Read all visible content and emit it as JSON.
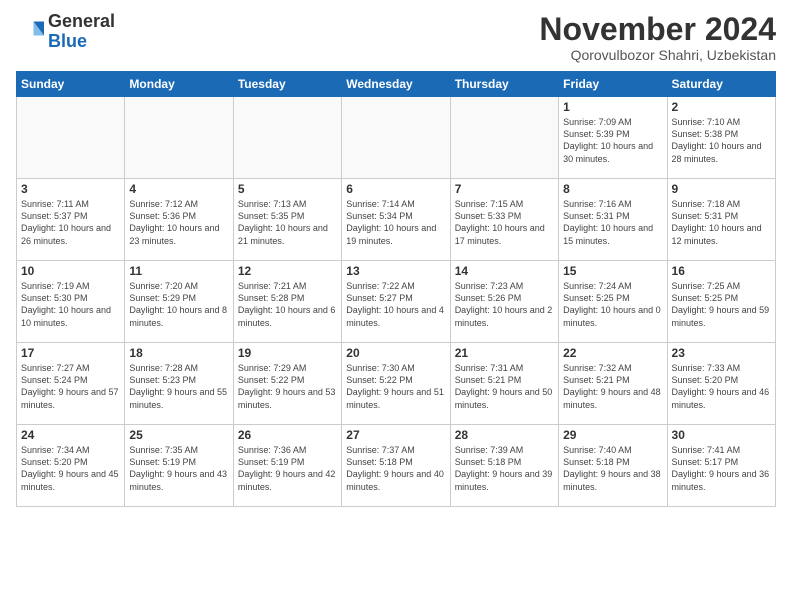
{
  "header": {
    "logo_general": "General",
    "logo_blue": "Blue",
    "month_title": "November 2024",
    "location": "Qorovulbozor Shahri, Uzbekistan"
  },
  "weekdays": [
    "Sunday",
    "Monday",
    "Tuesday",
    "Wednesday",
    "Thursday",
    "Friday",
    "Saturday"
  ],
  "weeks": [
    [
      {
        "day": "",
        "info": ""
      },
      {
        "day": "",
        "info": ""
      },
      {
        "day": "",
        "info": ""
      },
      {
        "day": "",
        "info": ""
      },
      {
        "day": "",
        "info": ""
      },
      {
        "day": "1",
        "info": "Sunrise: 7:09 AM\nSunset: 5:39 PM\nDaylight: 10 hours\nand 30 minutes."
      },
      {
        "day": "2",
        "info": "Sunrise: 7:10 AM\nSunset: 5:38 PM\nDaylight: 10 hours\nand 28 minutes."
      }
    ],
    [
      {
        "day": "3",
        "info": "Sunrise: 7:11 AM\nSunset: 5:37 PM\nDaylight: 10 hours\nand 26 minutes."
      },
      {
        "day": "4",
        "info": "Sunrise: 7:12 AM\nSunset: 5:36 PM\nDaylight: 10 hours\nand 23 minutes."
      },
      {
        "day": "5",
        "info": "Sunrise: 7:13 AM\nSunset: 5:35 PM\nDaylight: 10 hours\nand 21 minutes."
      },
      {
        "day": "6",
        "info": "Sunrise: 7:14 AM\nSunset: 5:34 PM\nDaylight: 10 hours\nand 19 minutes."
      },
      {
        "day": "7",
        "info": "Sunrise: 7:15 AM\nSunset: 5:33 PM\nDaylight: 10 hours\nand 17 minutes."
      },
      {
        "day": "8",
        "info": "Sunrise: 7:16 AM\nSunset: 5:31 PM\nDaylight: 10 hours\nand 15 minutes."
      },
      {
        "day": "9",
        "info": "Sunrise: 7:18 AM\nSunset: 5:31 PM\nDaylight: 10 hours\nand 12 minutes."
      }
    ],
    [
      {
        "day": "10",
        "info": "Sunrise: 7:19 AM\nSunset: 5:30 PM\nDaylight: 10 hours\nand 10 minutes."
      },
      {
        "day": "11",
        "info": "Sunrise: 7:20 AM\nSunset: 5:29 PM\nDaylight: 10 hours\nand 8 minutes."
      },
      {
        "day": "12",
        "info": "Sunrise: 7:21 AM\nSunset: 5:28 PM\nDaylight: 10 hours\nand 6 minutes."
      },
      {
        "day": "13",
        "info": "Sunrise: 7:22 AM\nSunset: 5:27 PM\nDaylight: 10 hours\nand 4 minutes."
      },
      {
        "day": "14",
        "info": "Sunrise: 7:23 AM\nSunset: 5:26 PM\nDaylight: 10 hours\nand 2 minutes."
      },
      {
        "day": "15",
        "info": "Sunrise: 7:24 AM\nSunset: 5:25 PM\nDaylight: 10 hours\nand 0 minutes."
      },
      {
        "day": "16",
        "info": "Sunrise: 7:25 AM\nSunset: 5:25 PM\nDaylight: 9 hours\nand 59 minutes."
      }
    ],
    [
      {
        "day": "17",
        "info": "Sunrise: 7:27 AM\nSunset: 5:24 PM\nDaylight: 9 hours\nand 57 minutes."
      },
      {
        "day": "18",
        "info": "Sunrise: 7:28 AM\nSunset: 5:23 PM\nDaylight: 9 hours\nand 55 minutes."
      },
      {
        "day": "19",
        "info": "Sunrise: 7:29 AM\nSunset: 5:22 PM\nDaylight: 9 hours\nand 53 minutes."
      },
      {
        "day": "20",
        "info": "Sunrise: 7:30 AM\nSunset: 5:22 PM\nDaylight: 9 hours\nand 51 minutes."
      },
      {
        "day": "21",
        "info": "Sunrise: 7:31 AM\nSunset: 5:21 PM\nDaylight: 9 hours\nand 50 minutes."
      },
      {
        "day": "22",
        "info": "Sunrise: 7:32 AM\nSunset: 5:21 PM\nDaylight: 9 hours\nand 48 minutes."
      },
      {
        "day": "23",
        "info": "Sunrise: 7:33 AM\nSunset: 5:20 PM\nDaylight: 9 hours\nand 46 minutes."
      }
    ],
    [
      {
        "day": "24",
        "info": "Sunrise: 7:34 AM\nSunset: 5:20 PM\nDaylight: 9 hours\nand 45 minutes."
      },
      {
        "day": "25",
        "info": "Sunrise: 7:35 AM\nSunset: 5:19 PM\nDaylight: 9 hours\nand 43 minutes."
      },
      {
        "day": "26",
        "info": "Sunrise: 7:36 AM\nSunset: 5:19 PM\nDaylight: 9 hours\nand 42 minutes."
      },
      {
        "day": "27",
        "info": "Sunrise: 7:37 AM\nSunset: 5:18 PM\nDaylight: 9 hours\nand 40 minutes."
      },
      {
        "day": "28",
        "info": "Sunrise: 7:39 AM\nSunset: 5:18 PM\nDaylight: 9 hours\nand 39 minutes."
      },
      {
        "day": "29",
        "info": "Sunrise: 7:40 AM\nSunset: 5:18 PM\nDaylight: 9 hours\nand 38 minutes."
      },
      {
        "day": "30",
        "info": "Sunrise: 7:41 AM\nSunset: 5:17 PM\nDaylight: 9 hours\nand 36 minutes."
      }
    ]
  ]
}
